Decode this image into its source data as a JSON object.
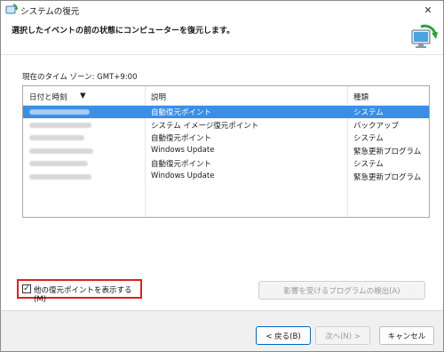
{
  "window": {
    "title": "システムの復元",
    "close_glyph": "✕"
  },
  "header": {
    "instruction": "選択したイベントの前の状態にコンピューターを復元します。"
  },
  "timezone_label": "現在のタイム ゾーン: GMT+9:00",
  "table": {
    "columns": [
      "日付と時刻",
      "説明",
      "種類"
    ],
    "rows": [
      {
        "datetime": "",
        "description": "自動復元ポイント",
        "type": "システム",
        "selected": true
      },
      {
        "datetime": "",
        "description": "システム イメージ復元ポイント",
        "type": "バックアップ",
        "selected": false
      },
      {
        "datetime": "",
        "description": "自動復元ポイント",
        "type": "システム",
        "selected": false
      },
      {
        "datetime": "",
        "description": "Windows Update",
        "type": "緊急更新プログラム",
        "selected": false
      },
      {
        "datetime": "",
        "description": "自動復元ポイント",
        "type": "システム",
        "selected": false
      },
      {
        "datetime": "",
        "description": "Windows Update",
        "type": "緊急更新プログラム",
        "selected": false
      }
    ]
  },
  "show_more_checkbox": {
    "label": "他の復元ポイントを表示する(M)",
    "checked": true,
    "check_glyph": "✓"
  },
  "buttons": {
    "scan_affected": "影響を受けるプログラムの検出(A)",
    "back": "< 戻る(B)",
    "next": "次へ(N) >",
    "cancel": "キャンセル"
  },
  "colors": {
    "selection": "#3a8ee6",
    "highlight_box": "#e02020"
  },
  "icons": [
    "system-restore-icon",
    "close-icon",
    "restore-computer-icon",
    "sort-arrow-icon",
    "checkmark-icon"
  ]
}
